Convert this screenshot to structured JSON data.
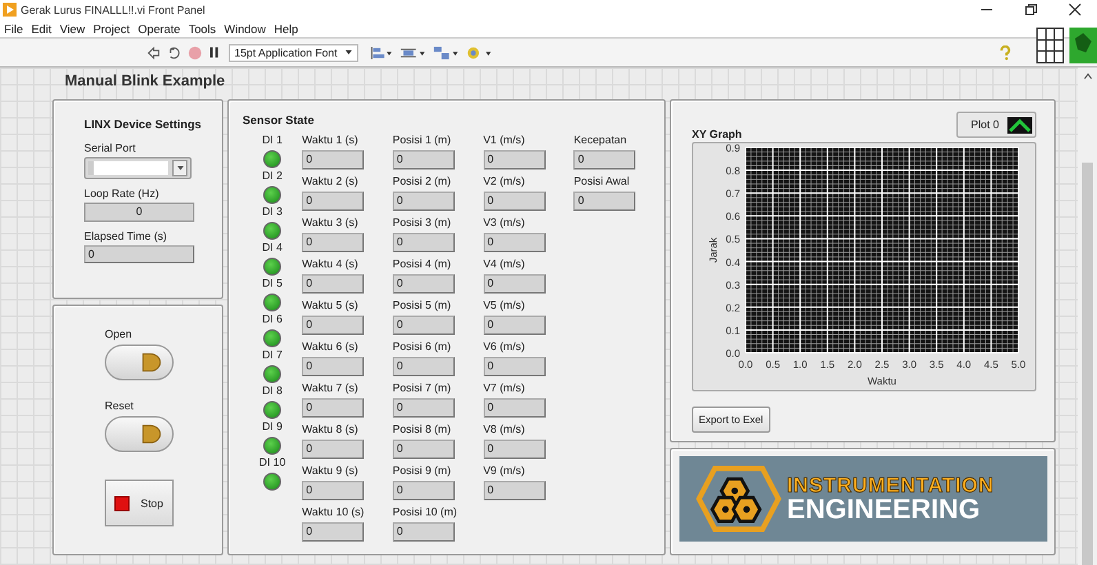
{
  "window": {
    "title": "Gerak Lurus FINALLL!!.vi Front Panel"
  },
  "menu": [
    "File",
    "Edit",
    "View",
    "Project",
    "Operate",
    "Tools",
    "Window",
    "Help"
  ],
  "toolbar": {
    "font": "15pt Application Font"
  },
  "heading": "Manual Blink Example",
  "linx": {
    "title": "LINX Device Settings",
    "fields": [
      {
        "kind": "dropdown",
        "label": "Serial Port"
      },
      {
        "kind": "control",
        "label": "Loop Rate (Hz)",
        "value": "0"
      },
      {
        "kind": "indicator",
        "label": "Elapsed Time (s)",
        "value": "0"
      }
    ]
  },
  "buttons": [
    {
      "kind": "oval",
      "label": "Open"
    },
    {
      "kind": "oval",
      "label": "Reset"
    },
    {
      "kind": "stop",
      "label": "Stop"
    }
  ],
  "sensor": {
    "title": "Sensor State",
    "leds": [
      {
        "label": "DI 1",
        "on": true
      },
      {
        "label": "DI 2",
        "on": true
      },
      {
        "label": "DI 3",
        "on": true
      },
      {
        "label": "DI 4",
        "on": true
      },
      {
        "label": "DI 5",
        "on": true
      },
      {
        "label": "DI 6",
        "on": true
      },
      {
        "label": "DI 7",
        "on": true
      },
      {
        "label": "DI 8",
        "on": true
      },
      {
        "label": "DI 9",
        "on": true
      },
      {
        "label": "DI 10",
        "on": true
      }
    ],
    "waktu": [
      {
        "label": "Waktu 1 (s)",
        "value": "0"
      },
      {
        "label": "Waktu 2 (s)",
        "value": "0"
      },
      {
        "label": "Waktu 3 (s)",
        "value": "0"
      },
      {
        "label": "Waktu 4 (s)",
        "value": "0"
      },
      {
        "label": "Waktu 5 (s)",
        "value": "0"
      },
      {
        "label": "Waktu 6 (s)",
        "value": "0"
      },
      {
        "label": "Waktu 7 (s)",
        "value": "0"
      },
      {
        "label": "Waktu 8 (s)",
        "value": "0"
      },
      {
        "label": "Waktu 9 (s)",
        "value": "0"
      },
      {
        "label": "Waktu 10 (s)",
        "value": "0"
      }
    ],
    "posisi": [
      {
        "label": "Posisi 1 (m)",
        "value": "0"
      },
      {
        "label": "Posisi 2 (m)",
        "value": "0"
      },
      {
        "label": "Posisi 3 (m)",
        "value": "0"
      },
      {
        "label": "Posisi 4 (m)",
        "value": "0"
      },
      {
        "label": "Posisi 5 (m)",
        "value": "0"
      },
      {
        "label": "Posisi 6 (m)",
        "value": "0"
      },
      {
        "label": "Posisi 7 (m)",
        "value": "0"
      },
      {
        "label": "Posisi 8 (m)",
        "value": "0"
      },
      {
        "label": "Posisi 9 (m)",
        "value": "0"
      },
      {
        "label": "Posisi 10 (m)",
        "value": "0"
      }
    ],
    "velocity": [
      {
        "label": "V1 (m/s)",
        "value": "0"
      },
      {
        "label": "V2 (m/s)",
        "value": "0"
      },
      {
        "label": "V3 (m/s)",
        "value": "0"
      },
      {
        "label": "V4 (m/s)",
        "value": "0"
      },
      {
        "label": "V5 (m/s)",
        "value": "0"
      },
      {
        "label": "V6 (m/s)",
        "value": "0"
      },
      {
        "label": "V7 (m/s)",
        "value": "0"
      },
      {
        "label": "V8 (m/s)",
        "value": "0"
      },
      {
        "label": "V9 (m/s)",
        "value": "0"
      }
    ],
    "summary": [
      {
        "label": "Kecepatan",
        "value": "0"
      },
      {
        "label": "Posisi Awal",
        "value": "0"
      }
    ]
  },
  "graph": {
    "title": "XY Graph",
    "export_button": "Export to Exel",
    "chart_data": {
      "type": "line",
      "grid": true,
      "xlabel": "Waktu",
      "ylabel": "Jarak",
      "ylim": [
        0,
        0.9
      ],
      "categories": [
        "0.0",
        "0.5",
        "1.0",
        "1.5",
        "2.0",
        "2.5",
        "3.0",
        "3.5",
        "4.0",
        "4.5",
        "5.0"
      ],
      "yticks": [
        {
          "value": 0,
          "label": "0.0"
        },
        {
          "value": 0.1,
          "label": "0.1"
        },
        {
          "value": 0.2,
          "label": "0.2"
        },
        {
          "value": 0.3,
          "label": "0.3"
        },
        {
          "value": 0.4,
          "label": "0.4"
        },
        {
          "value": 0.5,
          "label": "0.5"
        },
        {
          "value": 0.6,
          "label": "0.6"
        },
        {
          "value": 0.7,
          "label": "0.7"
        },
        {
          "value": 0.8,
          "label": "0.8"
        },
        {
          "value": 0.9,
          "label": "0.9"
        }
      ],
      "series": [
        {
          "name": "Plot 0",
          "color": "#22c43a",
          "values": [
            null,
            null,
            null,
            null,
            null,
            null,
            null,
            null,
            null,
            null,
            null
          ]
        }
      ]
    }
  },
  "logo": {
    "line1": "INSTRUMENTATION",
    "line2": "ENGINEERING"
  }
}
